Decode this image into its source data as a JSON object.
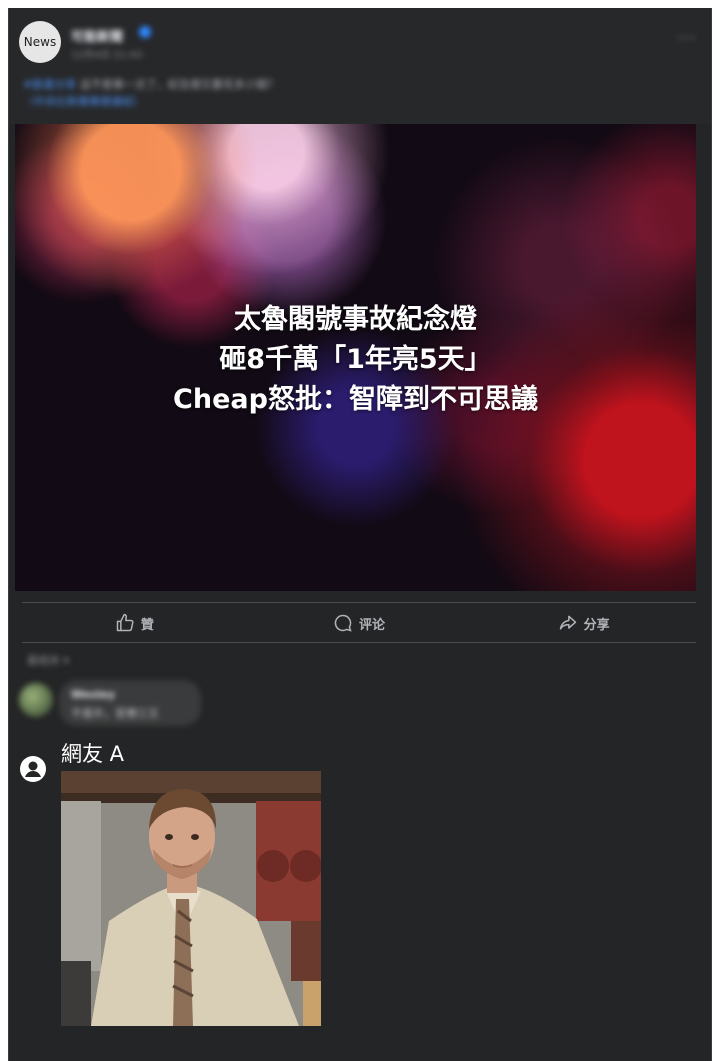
{
  "post": {
    "avatar_text": "News",
    "page_name": "可能新聞",
    "meta": "12月4日 21:43 · ",
    "caption_line1_link": "#臉書分享",
    "caption_line1_text": "這不是第一次了，紀念燈又要花多少錢？",
    "caption_line2": "（中央社新聞專題連結）",
    "more_label": "···"
  },
  "image": {
    "headline": [
      "太魯閣號事故紀念燈",
      "砸8千萬「1年亮5天」",
      "Cheap怒批：智障到不可思議"
    ]
  },
  "actions": {
    "like": "贊",
    "comment": "评论",
    "share": "分享"
  },
  "comments": {
    "sort_label": "最相关 ▾",
    "blurred_name": "Wesley",
    "blurred_text": "不意外，官僚三又",
    "user_name": "網友 A"
  }
}
